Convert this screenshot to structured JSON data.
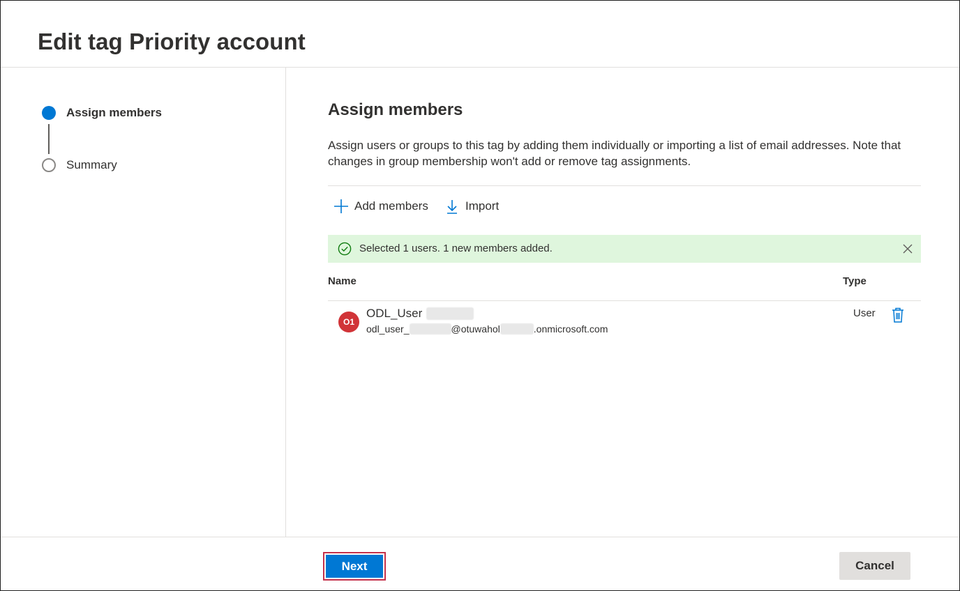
{
  "header": {
    "title": "Edit tag Priority account"
  },
  "steps": [
    {
      "label": "Assign members",
      "state": "active"
    },
    {
      "label": "Summary",
      "state": "pending"
    }
  ],
  "main": {
    "title": "Assign members",
    "description": "Assign users or groups to this tag by adding them individually or importing a list of email addresses. Note that changes in group membership won't add or remove tag assignments.",
    "commands": {
      "add_label": "Add members",
      "import_label": "Import"
    },
    "banner": {
      "message": "Selected 1 users. 1 new members added.",
      "icon": "check-circle-icon"
    },
    "table": {
      "columns": {
        "name": "Name",
        "type": "Type"
      },
      "rows": [
        {
          "initials": "O1",
          "name": "ODL_User",
          "email_prefix": "odl_user_",
          "email_mid": "@otuwahol",
          "email_suffix": ".onmicrosoft.com",
          "type": "User"
        }
      ]
    }
  },
  "footer": {
    "next_label": "Next",
    "cancel_label": "Cancel"
  },
  "colors": {
    "accent": "#0078d4",
    "success_bg": "#dff6dd",
    "success_icon": "#107c10",
    "avatar": "#d13438"
  }
}
